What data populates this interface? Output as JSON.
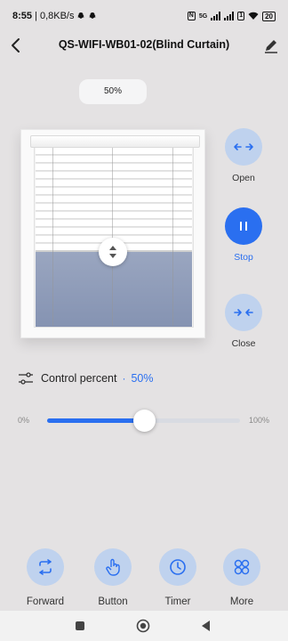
{
  "status_bar": {
    "time": "8:55",
    "network_speed": "| 0,8KB/s",
    "battery": "20",
    "network_badge": "5G"
  },
  "header": {
    "title": "QS-WIFI-WB01-02(Blind Curtain)"
  },
  "position_pill": {
    "text": "50%"
  },
  "curtain_position": 0.5,
  "controls": {
    "open_label": "Open",
    "stop_label": "Stop",
    "close_label": "Close"
  },
  "control_percent": {
    "label": "Control percent",
    "separator": "·",
    "value": "50%"
  },
  "slider": {
    "min_label": "0%",
    "max_label": "100%",
    "value": 50
  },
  "tabs": {
    "forward": "Forward",
    "button": "Button",
    "timer": "Timer",
    "more": "More"
  },
  "colors": {
    "accent": "#2a6ff0",
    "button_bg": "#bfd2ee",
    "background": "#e4e2e3"
  }
}
